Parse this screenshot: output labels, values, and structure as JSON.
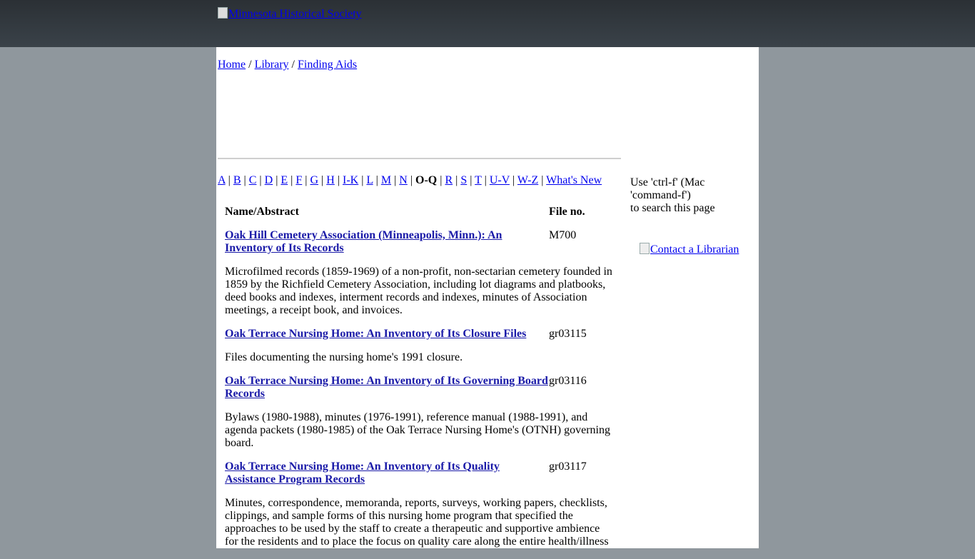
{
  "header": {
    "logo_alt": "Minnesota Historical Society"
  },
  "breadcrumb": {
    "items": [
      "Home",
      "Library",
      "Finding Aids"
    ],
    "separator": "/"
  },
  "alpha_nav": {
    "items": [
      "A",
      "B",
      "C",
      "D",
      "E",
      "F",
      "G",
      "H",
      "I-K",
      "L",
      "M",
      "N",
      "O-Q",
      "R",
      "S",
      "T",
      "U-V",
      "W-Z",
      "What's New"
    ],
    "current": "O-Q",
    "separator": "|"
  },
  "table": {
    "col_name": "Name/Abstract",
    "col_file": "File no.",
    "entries": [
      {
        "title": "Oak Hill Cemetery Association (Minneapolis, Minn.): An Inventory of Its Records",
        "file_no": "M700",
        "abstract": "Microfilmed records (1859-1969) of a non-profit, non-sectarian cemetery founded in 1859 by the Richfield Cemetery Association, including lot diagrams and platbooks, deed books and indexes, interment records and indexes, minutes of Association meetings, a receipt book, and invoices."
      },
      {
        "title": "Oak Terrace Nursing Home: An Inventory of Its Closure Files",
        "file_no": "gr03115",
        "abstract": "Files documenting the nursing home's 1991 closure."
      },
      {
        "title": "Oak Terrace Nursing Home: An Inventory of Its Governing Board Records",
        "file_no": "gr03116",
        "abstract": "Bylaws (1980-1988), minutes (1976-1991), reference manual (1988-1991), and agenda packets (1980-1985) of the Oak Terrace Nursing Home's (OTNH) governing board."
      },
      {
        "title": "Oak Terrace Nursing Home: An Inventory of Its Quality Assistance Program Records",
        "file_no": "gr03117",
        "abstract": "Minutes, correspondence, memoranda, reports, surveys, working papers, checklists, clippings, and sample forms of this nursing home program that specified the approaches to be used by the staff to create a therapeutic and supportive ambience for the residents and to place the focus on quality care along the entire health/illness"
      }
    ]
  },
  "sidebar": {
    "search_tip_line1": "Use 'ctrl-f' (Mac 'command-f')",
    "search_tip_line2": "to search this page",
    "contact_alt": "Contact a Librarian"
  }
}
